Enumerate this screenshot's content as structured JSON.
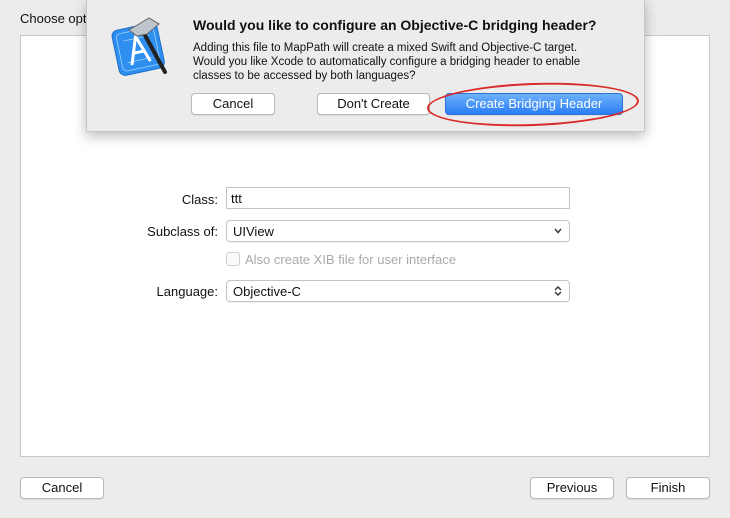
{
  "window": {
    "partial_header": "Choose opt"
  },
  "form": {
    "class_label": "Class:",
    "class_value": "ttt",
    "subclass_label": "Subclass of:",
    "subclass_value": "UIView",
    "xib_checkbox_label": "Also create XIB file for user interface",
    "xib_checked": false,
    "language_label": "Language:",
    "language_value": "Objective-C"
  },
  "footer": {
    "cancel_label": "Cancel",
    "previous_label": "Previous",
    "finish_label": "Finish"
  },
  "sheet": {
    "icon": "xcode-hammer-icon",
    "title": "Would you like to configure an Objective-C bridging header?",
    "message_line1": "Adding this file to MapPath will create a mixed Swift and Objective-C target.",
    "message_line2": "Would you like Xcode to automatically configure a bridging header to enable",
    "message_line3": "classes to be accessed by both languages?",
    "cancel_label": "Cancel",
    "dont_create_label": "Don't Create",
    "create_label": "Create Bridging Header"
  },
  "colors": {
    "primary_button": "#3b8af7",
    "highlight_ring": "#d92a2a"
  }
}
